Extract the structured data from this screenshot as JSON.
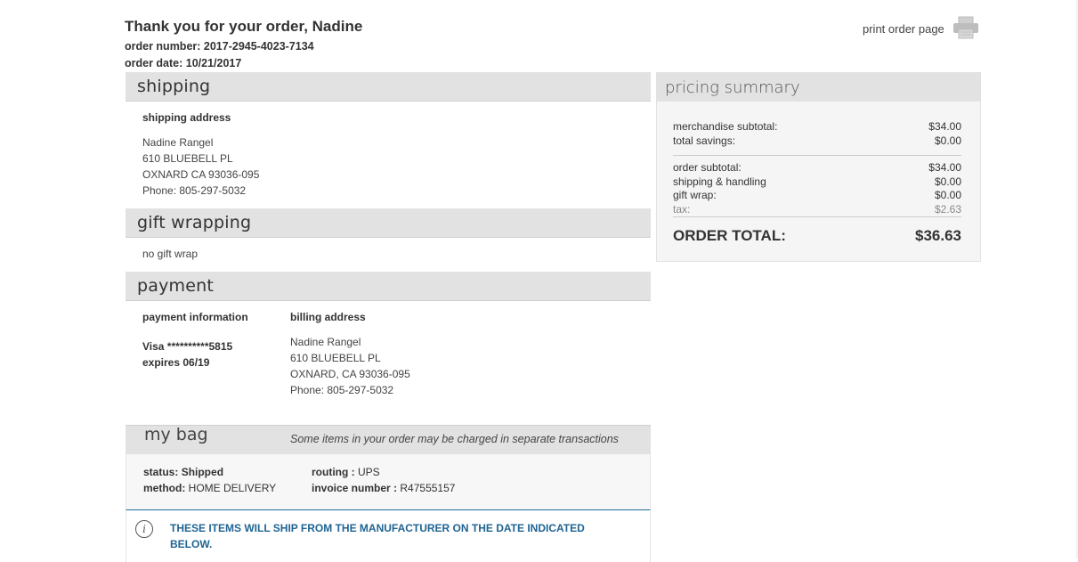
{
  "header": {
    "thank_you": "Thank you for your order, Nadine",
    "order_number": "order number: 2017-2945-4023-7134",
    "order_date": "order date: 10/21/2017",
    "print_label": "print order page"
  },
  "shipping": {
    "title": "shipping",
    "address_label": "shipping address",
    "name": "Nadine  Rangel",
    "street": "610 BLUEBELL PL",
    "city": "OXNARD CA 93036-095",
    "phone": "Phone: 805-297-5032"
  },
  "gift": {
    "title": "gift wrapping",
    "value": "no gift wrap"
  },
  "payment": {
    "title": "payment",
    "info_label": "payment information",
    "card": "Visa **********5815",
    "expires": "expires 06/19",
    "billing_label": "billing address",
    "billing_name": "Nadine  Rangel",
    "billing_street": "610 BLUEBELL PL",
    "billing_city": "OXNARD, CA 93036-095",
    "billing_phone": "Phone: 805-297-5032"
  },
  "pricing": {
    "title": "pricing summary",
    "rows_top": [
      {
        "label": "merchandise subtotal:",
        "value": "$34.00"
      },
      {
        "label": "total savings:",
        "value": "$0.00"
      }
    ],
    "rows_bottom": [
      {
        "label": "order subtotal:",
        "value": "$34.00"
      },
      {
        "label": "shipping & handling",
        "value": "$0.00"
      },
      {
        "label": "gift wrap:",
        "value": "$0.00"
      },
      {
        "label": "tax:",
        "value": "$2.63"
      }
    ],
    "total_label": "ORDER TOTAL:",
    "total_value": "$36.63"
  },
  "bag": {
    "title": "my bag",
    "note": "Some items in your order may be charged in separate transactions",
    "status_label": "status:",
    "status_value": "Shipped",
    "method_label": "method:",
    "method_value": "HOME DELIVERY",
    "routing_label": "routing :",
    "routing_value": "UPS",
    "invoice_label": "invoice number :",
    "invoice_value": "R47555157",
    "notice_icon": "info-icon",
    "notice": "THESE ITEMS WILL SHIP FROM THE MANUFACTURER ON THE DATE INDICATED BELOW."
  },
  "colors": {
    "section_bar": "#e2e2e2",
    "notice_text": "#1f6493",
    "notice_border": "#1f6f9b"
  }
}
